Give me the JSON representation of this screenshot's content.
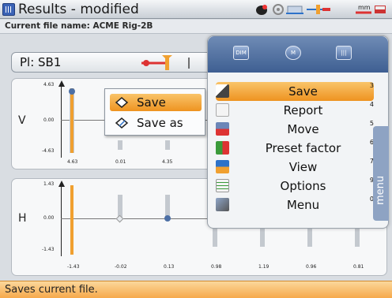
{
  "titlebar": {
    "title": "Results - modified",
    "icons": [
      "app-grid-icon",
      "machine-icon",
      "gear-settings-icon",
      "pump-motor-icon",
      "coupling-icon",
      "units-mm-icon"
    ],
    "units_label": "mm"
  },
  "file": {
    "label": "Current file name: ACME Rig-2B"
  },
  "plane": {
    "label": "Pl: SB1"
  },
  "v_panel": {
    "axis": "V",
    "y_ticks": [
      "4.63",
      "0.00",
      "-4.63"
    ],
    "x_ticks": [
      "4.63",
      "0.01",
      "4.35"
    ]
  },
  "h_panel": {
    "axis": "H",
    "y_ticks": [
      "1.43",
      "0.00",
      "-1.43"
    ],
    "x_ticks": [
      "-1.43",
      "-0.02",
      "0.13",
      "0.98",
      "1.19",
      "0.96",
      "0.81"
    ]
  },
  "submenu": {
    "items": [
      {
        "label": "Save",
        "icon": "save-icon",
        "selected": true
      },
      {
        "label": "Save as",
        "icon": "save-as-icon",
        "selected": false
      }
    ]
  },
  "menu": {
    "header_buttons": [
      {
        "label": "DIM"
      },
      {
        "label": "M"
      },
      {
        "label": "|||"
      }
    ],
    "items": [
      {
        "label": "Save",
        "num": "3",
        "icon": "save-icon",
        "selected": true
      },
      {
        "label": "Report",
        "num": "4",
        "icon": "report-icon",
        "selected": false
      },
      {
        "label": "Move",
        "num": "5",
        "icon": "move-icon",
        "selected": false
      },
      {
        "label": "Preset factor",
        "num": "6",
        "icon": "preset-factor-icon",
        "selected": false
      },
      {
        "label": "View",
        "num": "7",
        "icon": "view-icon",
        "selected": false
      },
      {
        "label": "Options",
        "num": "9",
        "icon": "options-icon",
        "selected": false
      },
      {
        "label": "Menu",
        "num": "0",
        "icon": "menu-icon",
        "selected": false
      }
    ],
    "side_tab": "menu"
  },
  "status": {
    "text": "Saves current file."
  },
  "colors": {
    "accent": "#f0a030",
    "header_blue": "#4a6a9c"
  }
}
